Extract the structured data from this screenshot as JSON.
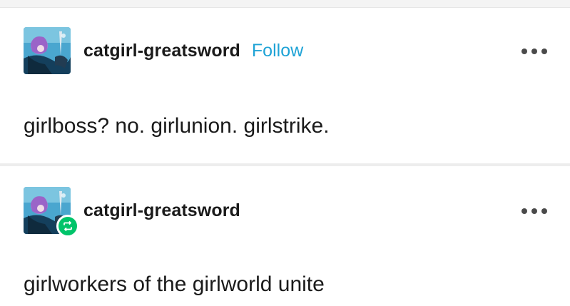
{
  "posts": [
    {
      "username": "catgirl-greatsword",
      "follow_label": "Follow",
      "body": "girlboss? no. girlunion. girlstrike.",
      "more_icon": "ellipsis-icon",
      "avatar_icon": "avatar-image"
    },
    {
      "username": "catgirl-greatsword",
      "body": "girlworkers of the girlworld unite",
      "more_icon": "ellipsis-icon",
      "avatar_icon": "avatar-image",
      "badge_icon": "reblog-icon"
    }
  ],
  "colors": {
    "follow": "#1fa3d6",
    "reblog_badge": "#00c46a",
    "text": "#1a1a1a"
  }
}
